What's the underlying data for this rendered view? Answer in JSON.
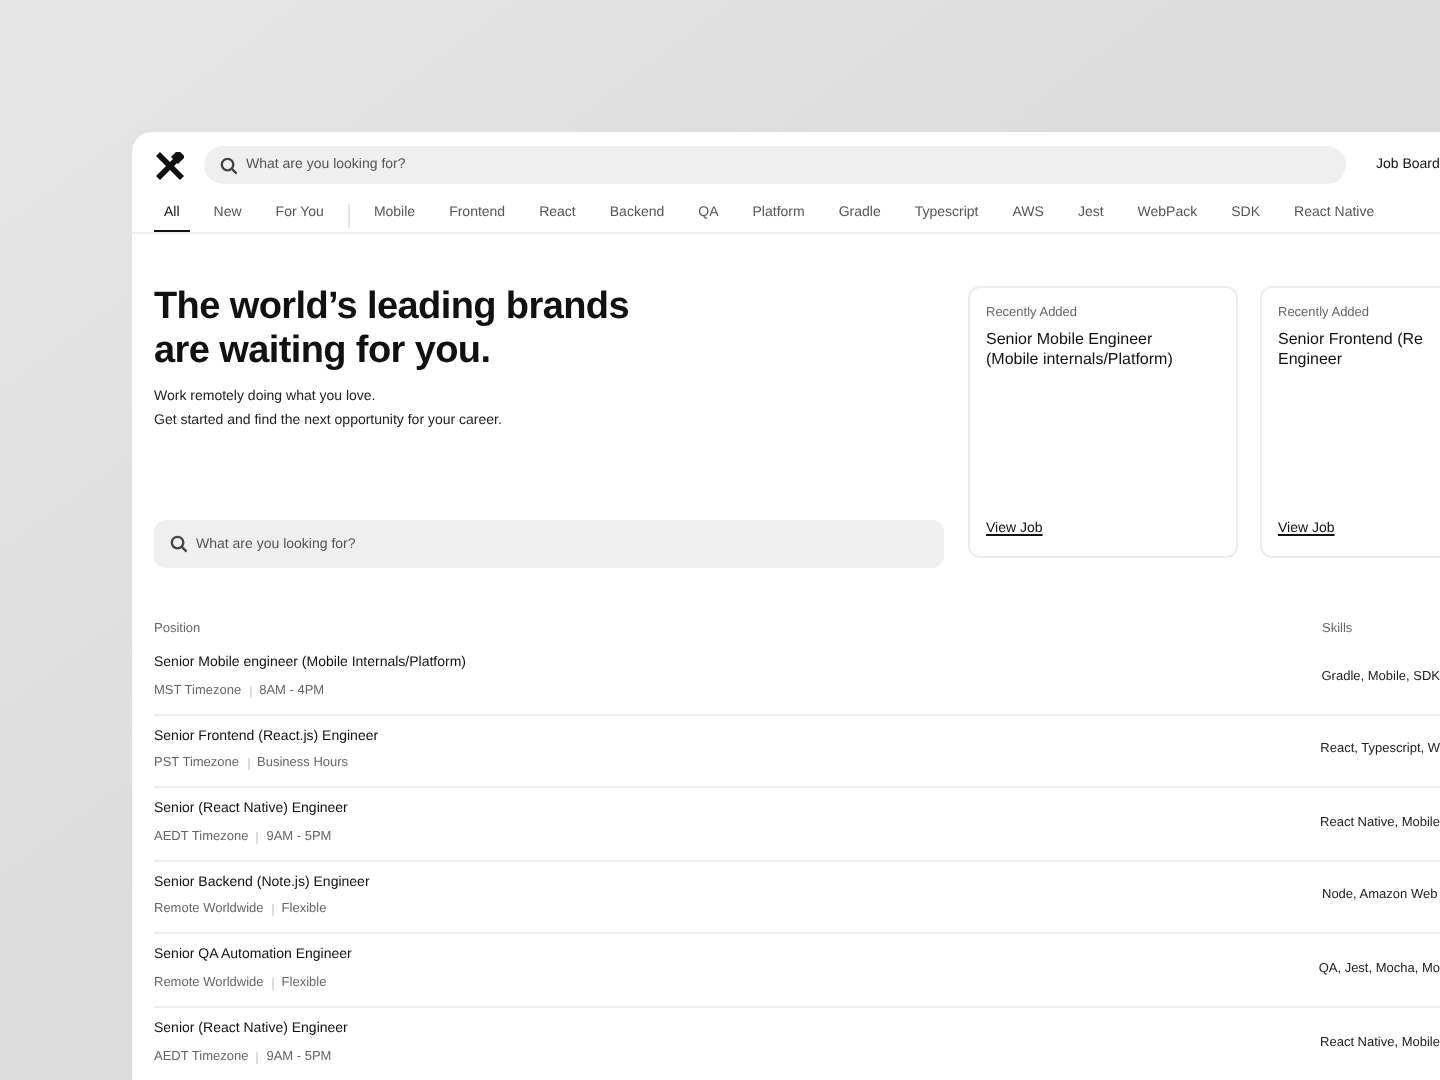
{
  "header": {
    "search": {
      "placeholder": "What are you looking for?"
    },
    "link": "Job Board"
  },
  "tabs": [
    {
      "label": "All",
      "selected": true
    },
    {
      "label": "New",
      "selected": false
    },
    {
      "label": "For You",
      "selected": false
    },
    {
      "label": "Mobile",
      "selected": false
    },
    {
      "label": "Frontend",
      "selected": false
    },
    {
      "label": "React",
      "selected": false
    },
    {
      "label": "Backend",
      "selected": false
    },
    {
      "label": "QA",
      "selected": false
    },
    {
      "label": "Platform",
      "selected": false
    },
    {
      "label": "Gradle",
      "selected": false
    },
    {
      "label": "Typescript",
      "selected": false
    },
    {
      "label": "AWS",
      "selected": false
    },
    {
      "label": "Jest",
      "selected": false
    },
    {
      "label": "WebPack",
      "selected": false
    },
    {
      "label": "SDK",
      "selected": false
    },
    {
      "label": "React Native",
      "selected": false
    }
  ],
  "hero": {
    "title_lines": [
      "The world’s leading brands",
      "are waiting for you."
    ],
    "subtitle_lines": [
      "Work remotely doing what you love.",
      "Get started and find the next opportunity for your career."
    ],
    "search": {
      "placeholder": "What are you looking for?"
    }
  },
  "cards": [
    {
      "tag": "Recently Added",
      "title_lines": [
        "Senior Mobile Engineer",
        "(Mobile internals/Platform)"
      ],
      "link": "View Job"
    },
    {
      "tag": "Recently Added",
      "title_lines": [
        "Senior Frontend (Re",
        "Engineer"
      ],
      "link": "View Job"
    }
  ],
  "table": {
    "columns": [
      "Position",
      "Skills"
    ],
    "rows": [
      {
        "title": "Senior Mobile engineer (Mobile Internals/Platform)",
        "timezone": "MST Timezone",
        "hours": "8AM - 4PM",
        "skills": "Gradle, Mobile, SDK"
      },
      {
        "title": "Senior Frontend (React.js) Engineer",
        "timezone": "PST Timezone",
        "hours": "Business Hours",
        "skills": "React, Typescript, W"
      },
      {
        "title": "Senior (React Native) Engineer",
        "timezone": "AEDT Timezone",
        "hours": "9AM - 5PM",
        "skills": "React Native, Mobile"
      },
      {
        "title": "Senior Backend (Note.js) Engineer",
        "timezone": "Remote Worldwide",
        "hours": "Flexible",
        "skills": "Node, Amazon Web"
      },
      {
        "title": "Senior QA Automation Engineer",
        "timezone": "Remote Worldwide",
        "hours": "Flexible",
        "skills": "QA, Jest, Mocha, Mo"
      },
      {
        "title": "Senior (React Native) Engineer",
        "timezone": "AEDT Timezone",
        "hours": "9AM - 5PM",
        "skills": "React Native, Mobile"
      }
    ]
  }
}
